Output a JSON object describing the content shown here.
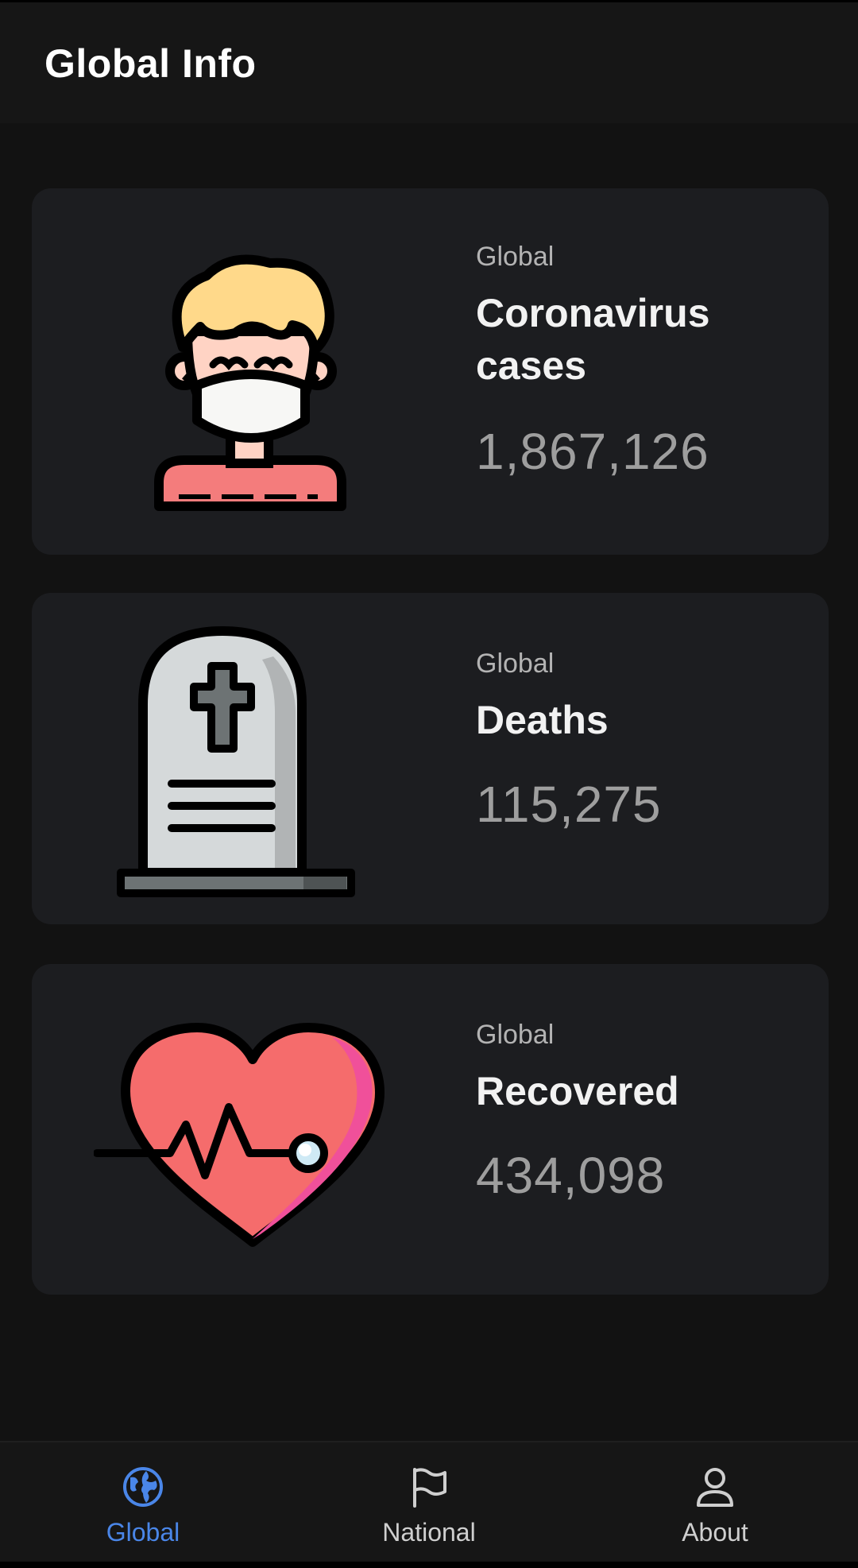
{
  "app_bar": {
    "title": "Global Info"
  },
  "cards": [
    {
      "kicker": "Global",
      "label": "Coronavirus cases",
      "value": "1,867,126",
      "icon": "masked-person-icon"
    },
    {
      "kicker": "Global",
      "label": "Deaths",
      "value": "115,275",
      "icon": "tombstone-icon"
    },
    {
      "kicker": "Global",
      "label": "Recovered",
      "value": "434,098",
      "icon": "heartbeat-icon"
    }
  ],
  "bottom_nav": {
    "items": [
      {
        "label": "Global",
        "icon": "globe-icon",
        "active": true
      },
      {
        "label": "National",
        "icon": "flag-icon",
        "active": false
      },
      {
        "label": "About",
        "icon": "person-icon",
        "active": false
      }
    ]
  },
  "colors": {
    "background": "#121212",
    "card": "#1c1d20",
    "accent": "#4a86e8",
    "skin": "#ffd3c4",
    "hair": "#ffd98a",
    "shirt": "#f47c7c",
    "heart": "#f56c6c",
    "heart_shade": "#f0509a",
    "stone": "#d5d9da",
    "stone_shade": "#b1b4b5"
  }
}
